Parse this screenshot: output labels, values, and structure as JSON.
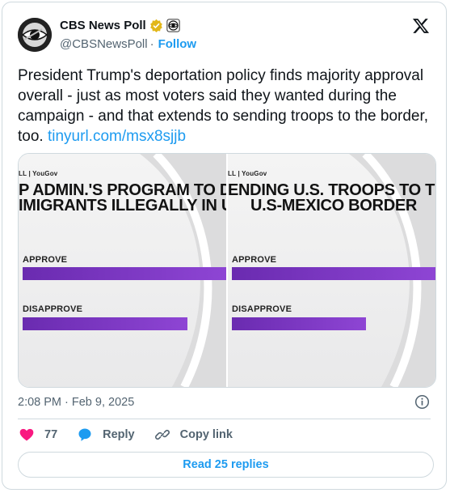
{
  "account": {
    "name": "CBS News Poll",
    "handle": "@CBSNewsPoll",
    "separator": "·",
    "follow_label": "Follow"
  },
  "tweet": {
    "text": "President Trump's deportation policy finds majority approval overall - just as most voters said they wanted during the campaign - and that extends to sending troops to the border, too.",
    "link": "tinyurl.com/msx8sjjb",
    "timestamp": "2:08 PM · Feb 9, 2025"
  },
  "media": {
    "panels": [
      {
        "source": "LL | YouGov",
        "title_line1": "P ADMIN.'S PROGRAM TO DE",
        "title_line2": "IMIGRANTS ILLEGALLY IN U.",
        "approve_label": "APPROVE",
        "disapprove_label": "DISAPPROVE",
        "approve_value": 1.0,
        "disapprove_value": 0.81
      },
      {
        "source": "LL | YouGov",
        "title_line1": "ENDING U.S. TROOPS TO TH",
        "title_line2": "U.S-MEXICO BORDER",
        "approve_label": "APPROVE",
        "disapprove_label": "DISAPPROVE",
        "approve_value": 1.0,
        "disapprove_value": 0.66
      }
    ]
  },
  "actions": {
    "likes": "77",
    "reply_label": "Reply",
    "copy_link_label": "Copy link",
    "read_replies_label": "Read 25 replies"
  },
  "icons": [
    "cbs-eye-logo-icon",
    "verified-gold-badge-icon",
    "cbs-eye-affiliate-icon",
    "x-logo-icon",
    "info-icon",
    "heart-icon",
    "reply-bubble-icon",
    "link-icon"
  ],
  "colors": {
    "accent": "#1d9bf0",
    "like": "#f91880",
    "bar": "#7b35c1",
    "badge": "#e2b719"
  }
}
